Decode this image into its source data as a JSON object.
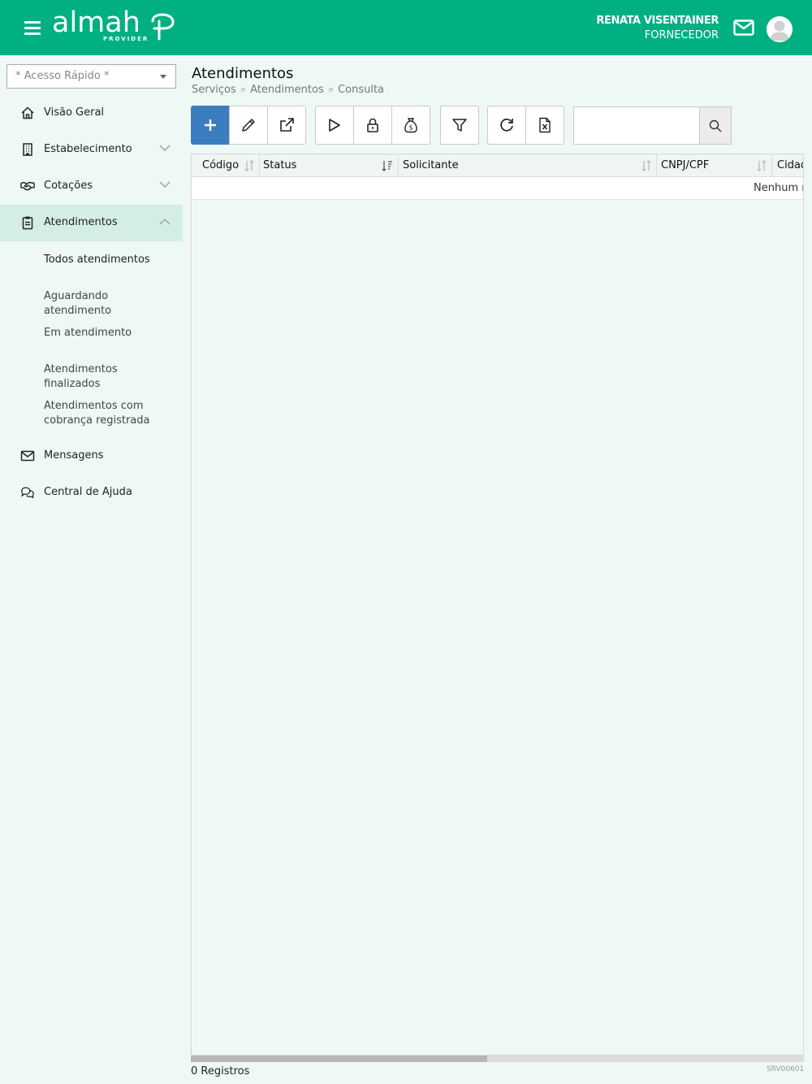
{
  "header": {
    "logo_text": "almah",
    "logo_sub": "PROVIDER",
    "user_name": "RENATA VISENTAINER",
    "user_role": "FORNECEDOR",
    "menu_icon": "hamburger-icon",
    "mail_icon": "envelope-icon",
    "avatar_icon": "user-avatar-icon",
    "brand_color": "#00b083"
  },
  "sidebar": {
    "quick_access_placeholder": "* Acesso Rápido *",
    "items": [
      {
        "label": "Visão Geral",
        "icon": "home-icon"
      },
      {
        "label": "Estabelecimento",
        "icon": "building-icon",
        "expandable": true
      },
      {
        "label": "Cotações",
        "icon": "handshake-icon",
        "expandable": true
      },
      {
        "label": "Atendimentos",
        "icon": "clipboard-icon",
        "expanded": true,
        "active": true
      },
      {
        "label": "Mensagens",
        "icon": "envelope-icon"
      },
      {
        "label": "Central de Ajuda",
        "icon": "chat-icon"
      }
    ],
    "subitems": [
      {
        "label": "Todos atendimentos"
      },
      {
        "label": "Aguardando atendimento"
      },
      {
        "label": "Em atendimento"
      },
      {
        "label": "Atendimentos finalizados"
      },
      {
        "label": "Atendimentos com cobrança registrada"
      }
    ]
  },
  "main": {
    "title": "Atendimentos",
    "breadcrumb": [
      "Serviços",
      "Atendimentos",
      "Consulta"
    ],
    "toolbar": {
      "buttons": [
        "plus-icon",
        "pencil-icon",
        "external-link-icon",
        "play-icon",
        "lock-icon",
        "money-bag-icon",
        "filter-icon",
        "refresh-icon",
        "excel-icon"
      ],
      "search_value": "",
      "search_icon": "search-icon",
      "accent": "#3b7ec0"
    },
    "table": {
      "columns": [
        "Código",
        "Status",
        "Solicitante",
        "CNPJ/CPF",
        "Cidade"
      ],
      "empty_text": "Nenhum registro encontrado",
      "rows": []
    },
    "records_label": "0 Registros",
    "screen_code": "SRV00601"
  }
}
